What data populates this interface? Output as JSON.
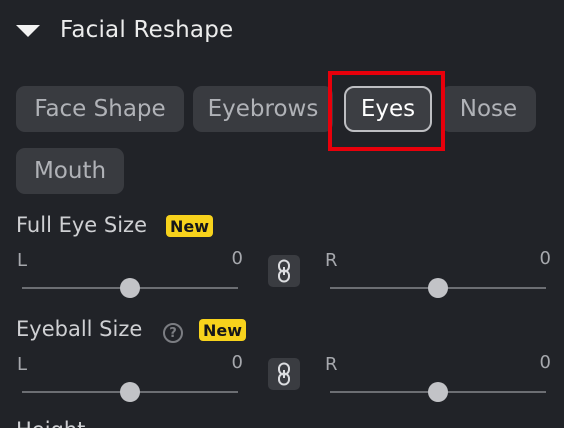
{
  "section": {
    "title": "Facial Reshape",
    "expand_icon": "triangle-down-icon"
  },
  "tabs": [
    {
      "label": "Face Shape",
      "active": false
    },
    {
      "label": "Eyebrows",
      "active": false
    },
    {
      "label": "Eyes",
      "active": true
    },
    {
      "label": "Nose",
      "active": false
    },
    {
      "label": "Mouth",
      "active": false
    }
  ],
  "controls": {
    "full_eye_size": {
      "label": "Full Eye Size",
      "badge": "New",
      "left": {
        "side": "L",
        "value": "0",
        "level": 0.5
      },
      "right": {
        "side": "R",
        "value": "0",
        "level": 0.5
      },
      "link_icon": "link-icon"
    },
    "eyeball_size": {
      "label": "Eyeball Size",
      "help_icon": "help-icon",
      "help_glyph": "?",
      "badge": "New",
      "left": {
        "side": "L",
        "value": "0",
        "level": 0.5
      },
      "right": {
        "side": "R",
        "value": "0",
        "level": 0.5
      },
      "link_icon": "link-icon"
    },
    "next": {
      "label": "Height"
    }
  },
  "colors": {
    "background": "#212328",
    "chip": "#393b40",
    "active_border": "#bdbec2",
    "badge": "#f7d21c",
    "highlight": "#e8000b"
  }
}
